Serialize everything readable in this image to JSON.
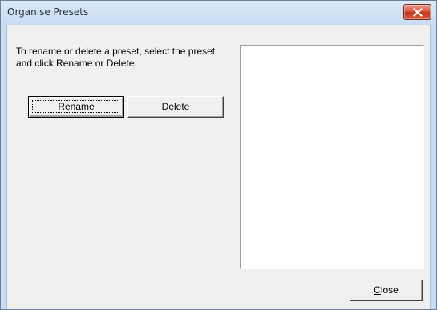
{
  "window": {
    "title": "Organise Presets"
  },
  "instructions": "To rename or delete a preset, select the preset and click Rename or Delete.",
  "buttons": {
    "rename_mnemonic": "R",
    "rename_rest": "ename",
    "delete_mnemonic": "D",
    "delete_rest": "elete",
    "close_mnemonic": "C",
    "close_rest": "lose"
  },
  "preset_list": {
    "items": []
  },
  "icons": {
    "close": "close-x-icon"
  },
  "colors": {
    "close_button": "#c8391c",
    "dialog_background": "#f0f0f0",
    "title_bar": "#d3e3f4"
  }
}
